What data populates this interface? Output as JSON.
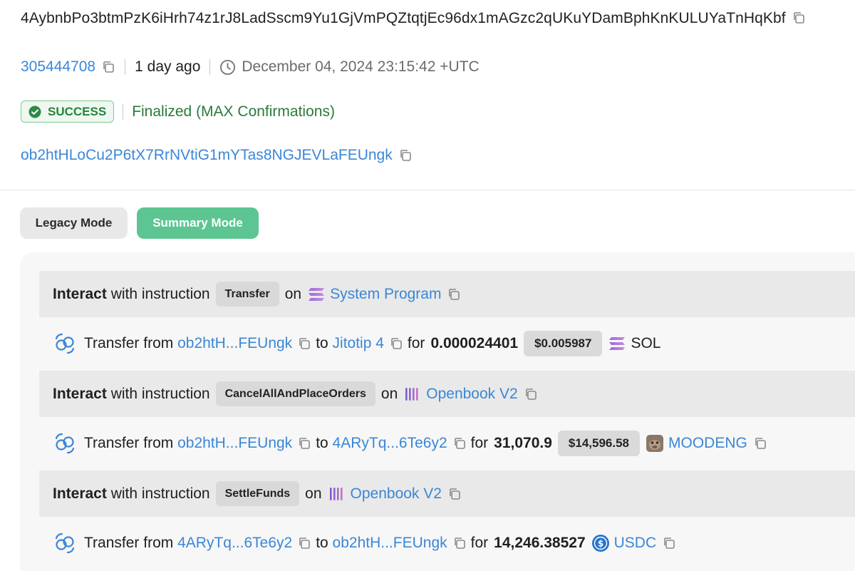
{
  "header": {
    "signature": "4AybnbPo3btmPzK6iHrh74z1rJ8LadSscm9Yu1GjVmPQZtqtjEc96dx1mAGzc2qUKuYDamBphKnKULUYaTnHqKbf"
  },
  "meta": {
    "slot": "305444708",
    "age": "1 day ago",
    "timestamp": "December 04, 2024 23:15:42 +UTC"
  },
  "status": {
    "badge": "SUCCESS",
    "confirmation": "Finalized (MAX Confirmations)"
  },
  "signer": "ob2htHLoCu2P6tX7RrNVtiG1mYTas8NGJEVLaFEUngk",
  "modes": {
    "legacy": "Legacy Mode",
    "summary": "Summary Mode"
  },
  "words": {
    "interact": "Interact",
    "with_instruction": "with instruction",
    "on": "on",
    "transfer_from": "Transfer from",
    "to": "to",
    "for": "for"
  },
  "instructions": [
    {
      "name": "Transfer",
      "program": "System Program",
      "program_icon": "solana-icon"
    },
    {
      "name": "CancelAllAndPlaceOrders",
      "program": "Openbook V2",
      "program_icon": "openbook-icon"
    },
    {
      "name": "SettleFunds",
      "program": "Openbook V2",
      "program_icon": "openbook-icon"
    }
  ],
  "transfers": [
    {
      "from": "ob2htH...FEUngk",
      "to": "Jitotip 4",
      "amount": "0.000024401",
      "usd": "$0.005987",
      "token": "SOL",
      "token_icon": "solana-icon"
    },
    {
      "from": "ob2htH...FEUngk",
      "to": "4ARyTq...6Te6y2",
      "amount": "31,070.9",
      "usd": "$14,596.58",
      "token": "MOODENG",
      "token_icon": "moodeng-icon"
    },
    {
      "from": "4ARyTq...6Te6y2",
      "to": "ob2htH...FEUngk",
      "amount": "14,246.38527",
      "usd": "",
      "token": "USDC",
      "token_icon": "usdc-icon"
    }
  ],
  "colors": {
    "link": "#3b86d6",
    "success": "#24843b",
    "summary_mode": "#5cc592"
  }
}
